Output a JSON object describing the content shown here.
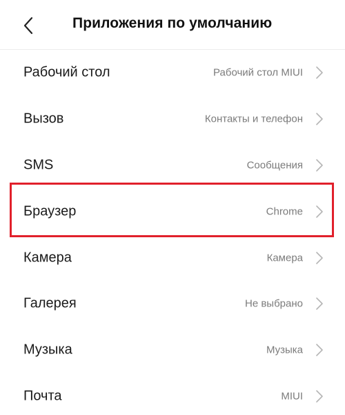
{
  "header": {
    "title": "Приложения по умолчанию",
    "back_icon": "chevron-left-icon"
  },
  "settings": [
    {
      "key": "desktop",
      "label": "Рабочий стол",
      "value": "Рабочий стол MIUI"
    },
    {
      "key": "call",
      "label": "Вызов",
      "value": "Контакты и телефон"
    },
    {
      "key": "sms",
      "label": "SMS",
      "value": "Сообщения"
    },
    {
      "key": "browser",
      "label": "Браузер",
      "value": "Chrome"
    },
    {
      "key": "camera",
      "label": "Камера",
      "value": "Камера"
    },
    {
      "key": "gallery",
      "label": "Галерея",
      "value": "Не выбрано"
    },
    {
      "key": "music",
      "label": "Музыка",
      "value": "Музыка"
    },
    {
      "key": "mail",
      "label": "Почта",
      "value": "MIUI"
    }
  ],
  "row_icon": "chevron-right-icon",
  "colors": {
    "highlight": "#e1202b",
    "title_text": "#111111",
    "label_text": "#1a1a1a",
    "value_text": "#7b7b7b",
    "chevron": "#b5b5b5",
    "divider": "#ececec"
  }
}
